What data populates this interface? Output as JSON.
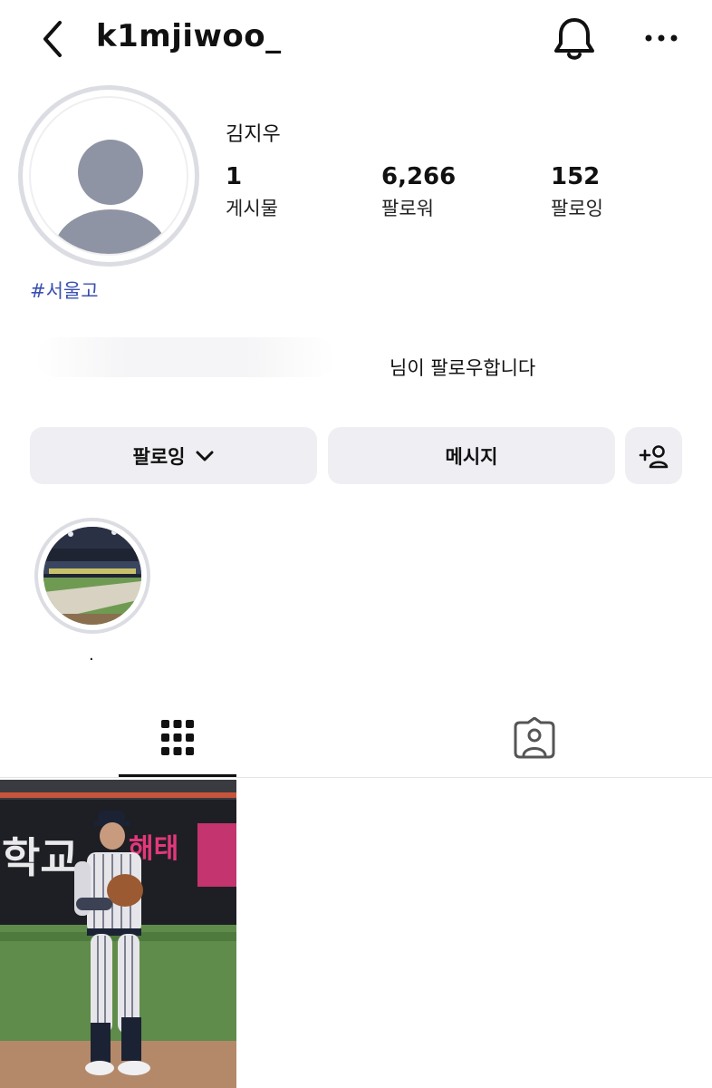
{
  "header": {
    "username": "k1mjiwoo_"
  },
  "profile": {
    "name": "김지우",
    "hashtag": "#서울고",
    "stats": [
      {
        "value": "1",
        "label": "게시물"
      },
      {
        "value": "6,266",
        "label": "팔로워"
      },
      {
        "value": "152",
        "label": "팔로잉"
      }
    ],
    "followed_by_text": "님이 팔로우합니다"
  },
  "actions": {
    "following_label": "팔로잉",
    "message_label": "메시지",
    "add_label": "+"
  },
  "highlights": [
    {
      "label": "."
    }
  ],
  "tabs": {
    "active": "grid",
    "items": [
      "grid-icon",
      "tagged-icon"
    ]
  },
  "posts": [
    {
      "sign_text": "학교",
      "sign_text_2": "해태"
    }
  ]
}
